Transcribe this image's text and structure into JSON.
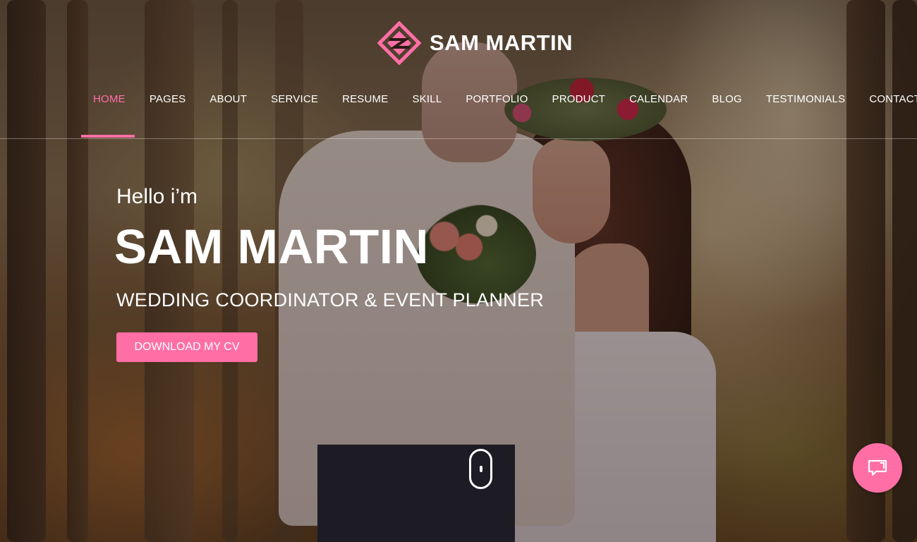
{
  "brand": {
    "name": "SAM MARTIN",
    "logo_icon": "diamond-logo-icon",
    "logo_color": "#ff6fa5"
  },
  "nav": {
    "items": [
      {
        "label": "HOME",
        "active": true
      },
      {
        "label": "PAGES",
        "active": false
      },
      {
        "label": "ABOUT",
        "active": false
      },
      {
        "label": "SERVICE",
        "active": false
      },
      {
        "label": "RESUME",
        "active": false
      },
      {
        "label": "SKILL",
        "active": false
      },
      {
        "label": "PORTFOLIO",
        "active": false
      },
      {
        "label": "PRODUCT",
        "active": false
      },
      {
        "label": "CALENDAR",
        "active": false
      },
      {
        "label": "BLOG",
        "active": false
      },
      {
        "label": "TESTIMONIALS",
        "active": false
      },
      {
        "label": "CONTACT",
        "active": false
      }
    ],
    "active_color": "#ff6fa5"
  },
  "hero": {
    "greeting": "Hello i’m",
    "name": "SAM MARTIN",
    "role": "WEDDING COORDINATOR & EVENT PLANNER",
    "cta_label": "DOWNLOAD MY CV",
    "accent_color": "#ff6fa5",
    "background": "photo-of-couple-in-forest"
  },
  "scroll_indicator": {
    "icon": "mouse-scroll-icon"
  },
  "chat": {
    "icon": "chat-bubble-icon"
  }
}
